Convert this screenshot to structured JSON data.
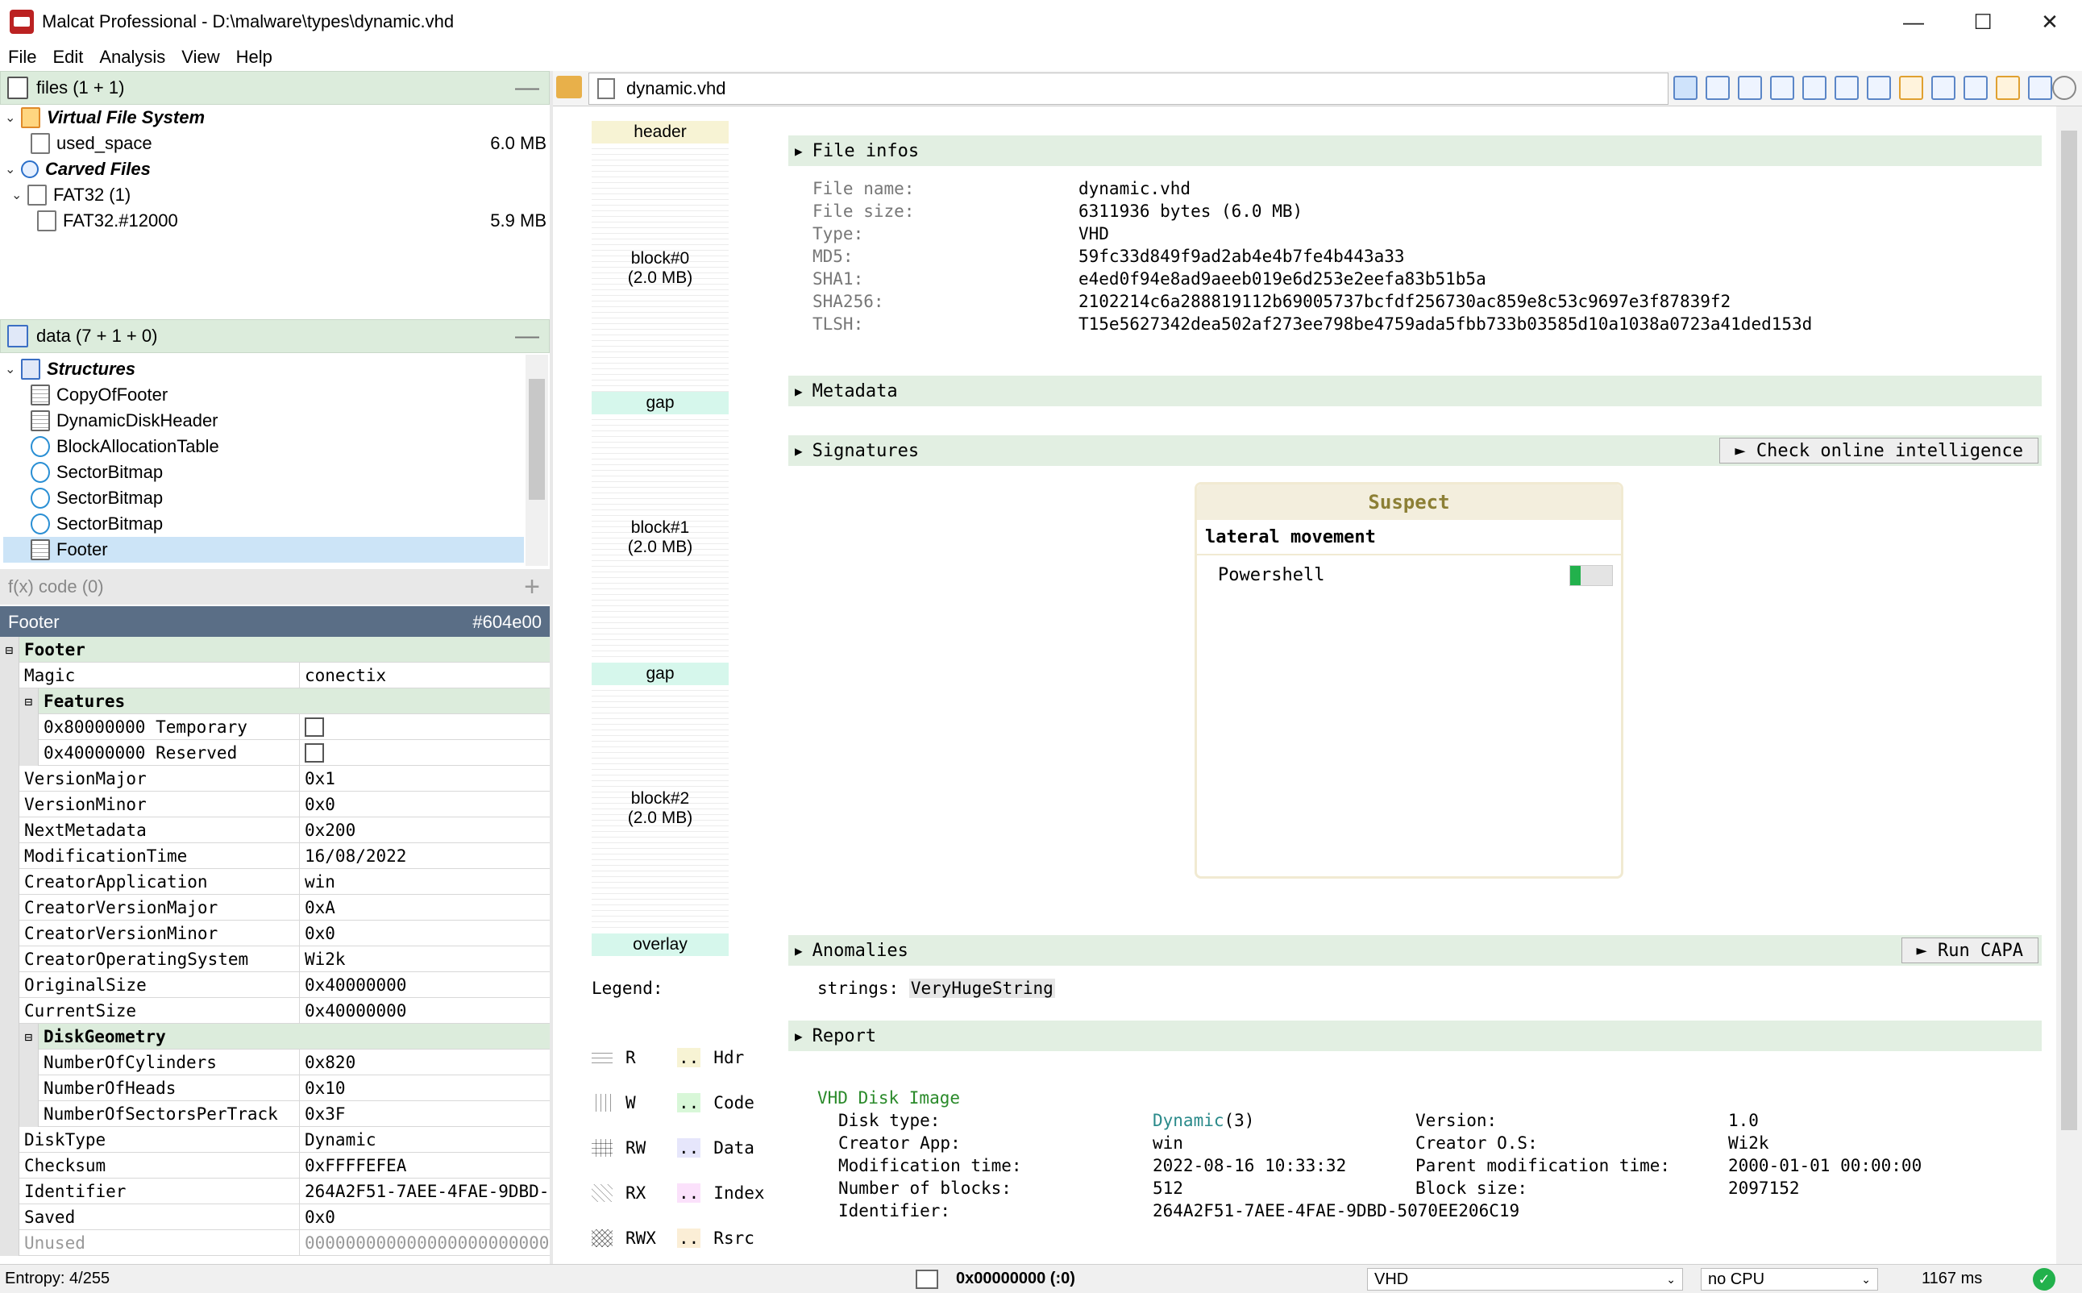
{
  "window": {
    "title": "Malcat Professional - D:\\malware\\types\\dynamic.vhd",
    "minimize": "—",
    "maximize": "☐",
    "close": "✕"
  },
  "menu": [
    "File",
    "Edit",
    "Analysis",
    "View",
    "Help"
  ],
  "files_pane": {
    "title": "files (1 + 1)",
    "collapse": "—",
    "items": [
      {
        "label": "Virtual File System",
        "size": ""
      },
      {
        "label": "used_space",
        "size": "6.0 MB"
      },
      {
        "label": "Carved Files",
        "size": ""
      },
      {
        "label": "FAT32 (1)",
        "size": ""
      },
      {
        "label": "FAT32.#12000",
        "size": "5.9 MB"
      }
    ]
  },
  "data_pane": {
    "title": "data (7 + 1 + 0)",
    "collapse": "—",
    "items": [
      {
        "label": "Structures"
      },
      {
        "label": "CopyOfFooter"
      },
      {
        "label": "DynamicDiskHeader"
      },
      {
        "label": "BlockAllocationTable"
      },
      {
        "label": "SectorBitmap"
      },
      {
        "label": "SectorBitmap"
      },
      {
        "label": "SectorBitmap"
      },
      {
        "label": "Footer"
      }
    ]
  },
  "code_bar": {
    "label": "f(x) code (0)",
    "add": "+"
  },
  "structure": {
    "name": "Footer",
    "offset": "#604e00",
    "rows": [
      {
        "k": "Footer",
        "v": "",
        "type": "group",
        "indent": 0
      },
      {
        "k": "Magic",
        "v": "conectix",
        "indent": 0
      },
      {
        "k": "Features",
        "v": "",
        "type": "group",
        "indent": 1
      },
      {
        "k": "0x80000000 Temporary",
        "v": "",
        "type": "check",
        "indent": 1
      },
      {
        "k": "0x40000000 Reserved",
        "v": "",
        "type": "check",
        "indent": 1
      },
      {
        "k": "VersionMajor",
        "v": "0x1",
        "indent": 0
      },
      {
        "k": "VersionMinor",
        "v": "0x0",
        "indent": 0
      },
      {
        "k": "NextMetadata",
        "v": "0x200",
        "indent": 0
      },
      {
        "k": "ModificationTime",
        "v": "16/08/2022",
        "indent": 0
      },
      {
        "k": "CreatorApplication",
        "v": "win",
        "indent": 0
      },
      {
        "k": "CreatorVersionMajor",
        "v": "0xA",
        "indent": 0
      },
      {
        "k": "CreatorVersionMinor",
        "v": "0x0",
        "indent": 0
      },
      {
        "k": "CreatorOperatingSystem",
        "v": "Wi2k",
        "indent": 0
      },
      {
        "k": "OriginalSize",
        "v": "0x40000000",
        "indent": 0
      },
      {
        "k": "CurrentSize",
        "v": "0x40000000",
        "indent": 0
      },
      {
        "k": "DiskGeometry",
        "v": "",
        "type": "group",
        "indent": 1
      },
      {
        "k": "NumberOfCylinders",
        "v": "0x820",
        "indent": 1
      },
      {
        "k": "NumberOfHeads",
        "v": "0x10",
        "indent": 1
      },
      {
        "k": "NumberOfSectorsPerTrack",
        "v": "0x3F",
        "indent": 1
      },
      {
        "k": "DiskType",
        "v": "Dynamic",
        "indent": 0
      },
      {
        "k": "Checksum",
        "v": "0xFFFFEFEA",
        "indent": 0
      },
      {
        "k": "Identifier",
        "v": "264A2F51-7AEE-4FAE-9DBD-",
        "indent": 0
      },
      {
        "k": "Saved",
        "v": "0x0",
        "indent": 0
      },
      {
        "k": "Unused",
        "v": "000000000000000000000000",
        "indent": 0,
        "type": "grey"
      }
    ]
  },
  "tab": {
    "filename": "dynamic.vhd"
  },
  "map": {
    "segments": [
      {
        "label": "header",
        "size": ""
      },
      {
        "label": "block#0",
        "size": "(2.0 MB)"
      },
      {
        "label": "gap",
        "size": ""
      },
      {
        "label": "block#1",
        "size": "(2.0 MB)"
      },
      {
        "label": "gap",
        "size": ""
      },
      {
        "label": "block#2",
        "size": "(2.0 MB)"
      },
      {
        "label": "overlay",
        "size": ""
      }
    ],
    "legend_title": "Legend:",
    "legend": [
      {
        "label": "R"
      },
      {
        "label": "Hdr"
      },
      {
        "label": "W"
      },
      {
        "label": "Code"
      },
      {
        "label": "RW"
      },
      {
        "label": "Data"
      },
      {
        "label": "RX"
      },
      {
        "label": "Index"
      },
      {
        "label": "RWX"
      },
      {
        "label": "Rsrc"
      }
    ],
    "legend_dots": ".."
  },
  "summary": {
    "file_infos": {
      "title": "File infos",
      "rows": [
        {
          "k": "File name:",
          "v": "dynamic.vhd"
        },
        {
          "k": "File size:",
          "v": "6311936 bytes (6.0 MB)"
        },
        {
          "k": "Type:",
          "v": "VHD"
        },
        {
          "k": "MD5:",
          "v": "59fc33d849f9ad2ab4e4b7fe4b443a33"
        },
        {
          "k": "SHA1:",
          "v": "e4ed0f94e8ad9aeeb019e6d253e2eefa83b51b5a"
        },
        {
          "k": "SHA256:",
          "v": "2102214c6a288819112b69005737bcfdf256730ac859e8c53c9697e3f87839f2"
        },
        {
          "k": "TLSH:",
          "v": "T15e5627342dea502af273ee798be4759ada5fbb733b03585d10a1038a0723a41ded153d"
        }
      ]
    },
    "metadata": {
      "title": "Metadata"
    },
    "signatures": {
      "title": "Signatures",
      "button": "► Check online intelligence",
      "card": {
        "level": "Suspect",
        "category": "lateral movement",
        "rule": "Powershell",
        "score_fraction": 0.25
      }
    },
    "anomalies": {
      "title": "Anomalies",
      "button": "► Run CAPA",
      "label": "strings:",
      "value": "VeryHugeString"
    },
    "report": {
      "title": "Report",
      "heading": "VHD Disk Image",
      "left": [
        {
          "k": "Disk type:",
          "v": "Dynamic",
          "extra": "(3)"
        },
        {
          "k": "Creator App:",
          "v": "win"
        },
        {
          "k": "Modification time:",
          "v": "2022-08-16 10:33:32"
        },
        {
          "k": "Number of blocks:",
          "v": "512"
        },
        {
          "k": "Identifier:",
          "v": "264A2F51-7AEE-4FAE-9DBD-5070EE206C19"
        }
      ],
      "right": [
        {
          "k": "Version:",
          "v": "1.0"
        },
        {
          "k": "Creator O.S:",
          "v": "Wi2k"
        },
        {
          "k": "Parent modification time:",
          "v": "2000-01-01 00:00:00"
        },
        {
          "k": "Block size:",
          "v": "2097152"
        }
      ]
    }
  },
  "status": {
    "entropy": "Entropy: 4/255",
    "address": "0x00000000 (:0)",
    "format": "VHD",
    "cpu": "no CPU",
    "time": "1167 ms"
  },
  "colors": {
    "pane_header": "#dcecdc",
    "section": "#e2efe2",
    "struct_header": "#5a6e86",
    "accent_green": "#22b14c"
  }
}
